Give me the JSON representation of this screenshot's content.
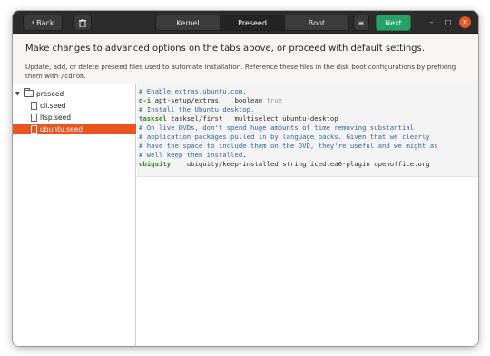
{
  "header": {
    "back_label": "Back",
    "tabs": [
      {
        "label": "Kernel"
      },
      {
        "label": "Preseed"
      },
      {
        "label": "Boot"
      }
    ],
    "next_label": "Next"
  },
  "intro": {
    "title": "Make changes to advanced options on the tabs above, or proceed with default settings.",
    "desc_part1": "Update, add, or delete preseed files used to automate installation. Reference these files in the disk boot configurations by prefixing them with ",
    "desc_mono": "/cdrom",
    "desc_part2": "."
  },
  "tree": {
    "folder": "preseed",
    "files": [
      "cli.seed",
      "ltsp.seed",
      "ubuntu.seed"
    ],
    "selected": "ubuntu.seed"
  },
  "editor": {
    "lines": [
      {
        "comment": "# Enable extras.ubuntu.com."
      },
      {
        "key": "d-i",
        "text": " apt-setup/extras    boolean ",
        "val": "true"
      },
      {
        "comment": "# Install the Ubuntu desktop."
      },
      {
        "key": "tasksel",
        "text": " tasksel/first   multiselect ubuntu-desktop"
      },
      {
        "comment": "# On live DVDs, don't spend huge amounts of time removing substantial"
      },
      {
        "comment": "# application packages pulled in by language packs. Given that we clearly"
      },
      {
        "comment": "# have the space to include them on the DVD, they're useful and we might as"
      },
      {
        "comment": "# well keep then installed."
      },
      {
        "key": "ubiquity",
        "text": "    ubiquity/keep-installed string icedtea6-plugin openoffice.org"
      }
    ]
  },
  "colors": {
    "accent": "#e95420",
    "next_button": "#26a269",
    "comment": "#3465a4",
    "keyword": "#2f8a1f"
  }
}
